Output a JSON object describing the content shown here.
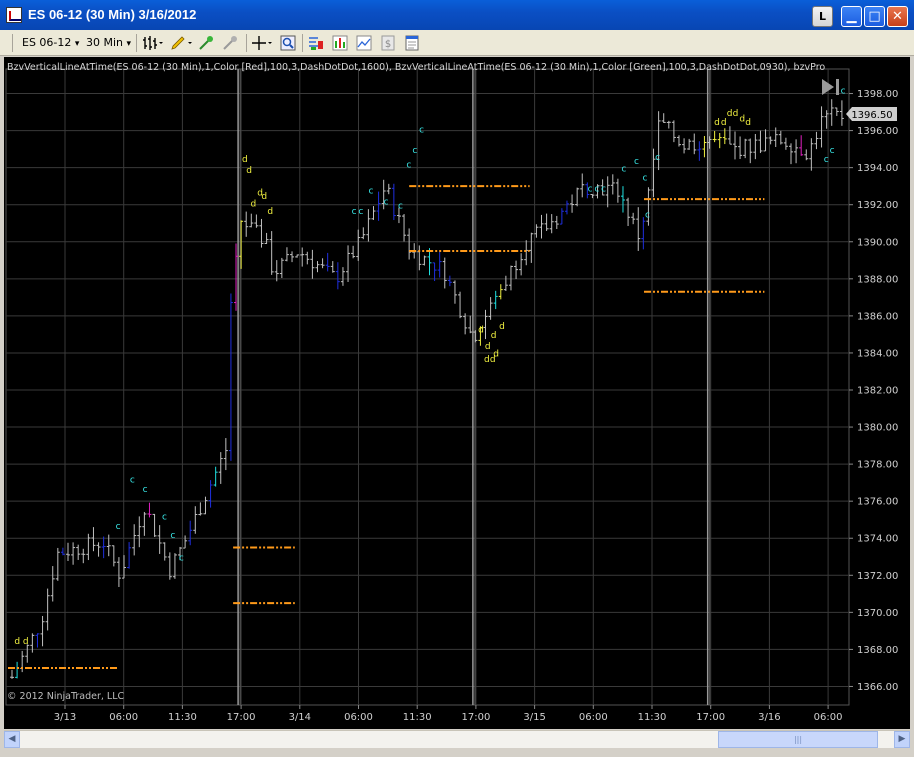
{
  "window": {
    "title": "ES 06-12 (30 Min)  3/16/2012",
    "l_button": "L"
  },
  "toolbar": {
    "instrument": "ES 06-12",
    "interval": "30 Min",
    "dropdown_glyph": "▾"
  },
  "chart": {
    "indicator_text": "BzvVerticalLineAtTime(ES 06-12 (30 Min),1,Color [Red],100,3,DashDotDot,1600), BzvVerticalLineAtTime(ES 06-12 (30 Min),1,Color [Green],100,3,DashDotDot,0930), bzvPro",
    "copyright": "© 2012 NinjaTrader, LLC",
    "price_marker": "1396.50",
    "colors": {
      "background": "#000000",
      "grid": "#3a3a3a",
      "bar_default": "#c0c0c0",
      "bar_blue": "#1f2fe0",
      "bar_cyan": "#20e0e0",
      "bar_magenta": "#e020c0",
      "bar_yellow": "#f0f040",
      "level_line": "#ff9a1a",
      "marker_c": "#38e8e8",
      "marker_d": "#f0f040"
    }
  },
  "chart_data": {
    "type": "candlestick",
    "ylim": [
      1365,
      1399
    ],
    "y_ticks": [
      "1398.00",
      "1396.00",
      "1394.00",
      "1392.00",
      "1390.00",
      "1388.00",
      "1386.00",
      "1384.00",
      "1382.00",
      "1380.00",
      "1378.00",
      "1376.00",
      "1374.00",
      "1372.00",
      "1370.00",
      "1368.00",
      "1366.00"
    ],
    "x_ticks": [
      "3/13",
      "06:00",
      "11:30",
      "17:00",
      "3/14",
      "06:00",
      "11:30",
      "17:00",
      "3/15",
      "06:00",
      "11:30",
      "17:00",
      "3/16",
      "06:00"
    ],
    "last_price": 1396.5,
    "levels": [
      {
        "price": 1367.0,
        "from": 0,
        "to": 1
      },
      {
        "price": 1373.5,
        "from": 3,
        "to": 4
      },
      {
        "price": 1370.5,
        "from": 3,
        "to": 4
      },
      {
        "price": 1393.0,
        "from": 6,
        "to": 8
      },
      {
        "price": 1389.5,
        "from": 6,
        "to": 8
      },
      {
        "price": 1392.3,
        "from": 10,
        "to": 12
      },
      {
        "price": 1387.3,
        "from": 10,
        "to": 12
      }
    ]
  }
}
